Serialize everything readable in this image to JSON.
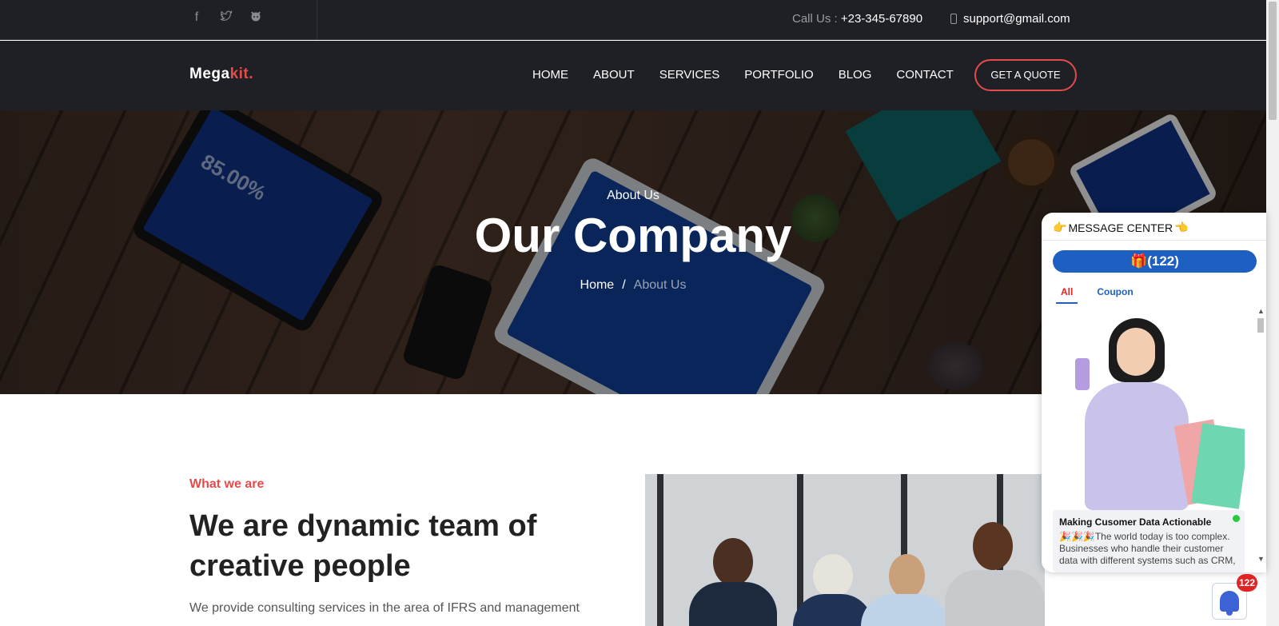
{
  "topbar": {
    "social": [
      {
        "icon": "facebook-icon",
        "glyph": "f"
      },
      {
        "icon": "twitter-icon",
        "glyph": "🐦"
      },
      {
        "icon": "github-icon",
        "glyph": "◉"
      }
    ],
    "call_label": "Call Us :",
    "call_number": "+23-345-67890",
    "email": "support@gmail.com"
  },
  "nav": {
    "logo_main": "Mega",
    "logo_accent": "kit.",
    "menu": [
      "HOME",
      "ABOUT",
      "SERVICES",
      "PORTFOLIO",
      "BLOG",
      "CONTACT"
    ],
    "quote_label": "GET A QUOTE"
  },
  "hero": {
    "eyebrow": "About Us",
    "title": "Our Company",
    "crumb_home": "Home",
    "crumb_sep": "/",
    "crumb_current": "About Us",
    "tablet_text": "85.00%"
  },
  "about": {
    "eyebrow": "What we are",
    "heading": "We are dynamic team of creative people",
    "paragraph": "We provide consulting services in the area of IFRS and management"
  },
  "message_center": {
    "title": "MESSAGE CENTER",
    "count": "🎁(122)",
    "tab_all": "All",
    "tab_coupon": "Coupon",
    "card_title": "Making Cusomer Data Actionable",
    "card_text": "🎉🎉🎉The world today is too complex. Businesses who handle their customer data with different systems such as CRM,"
  },
  "notification": {
    "badge": "122"
  },
  "colors": {
    "accent": "#e44b4b",
    "dark_bg": "#1f2025",
    "widget_blue": "#1e5fc2"
  }
}
